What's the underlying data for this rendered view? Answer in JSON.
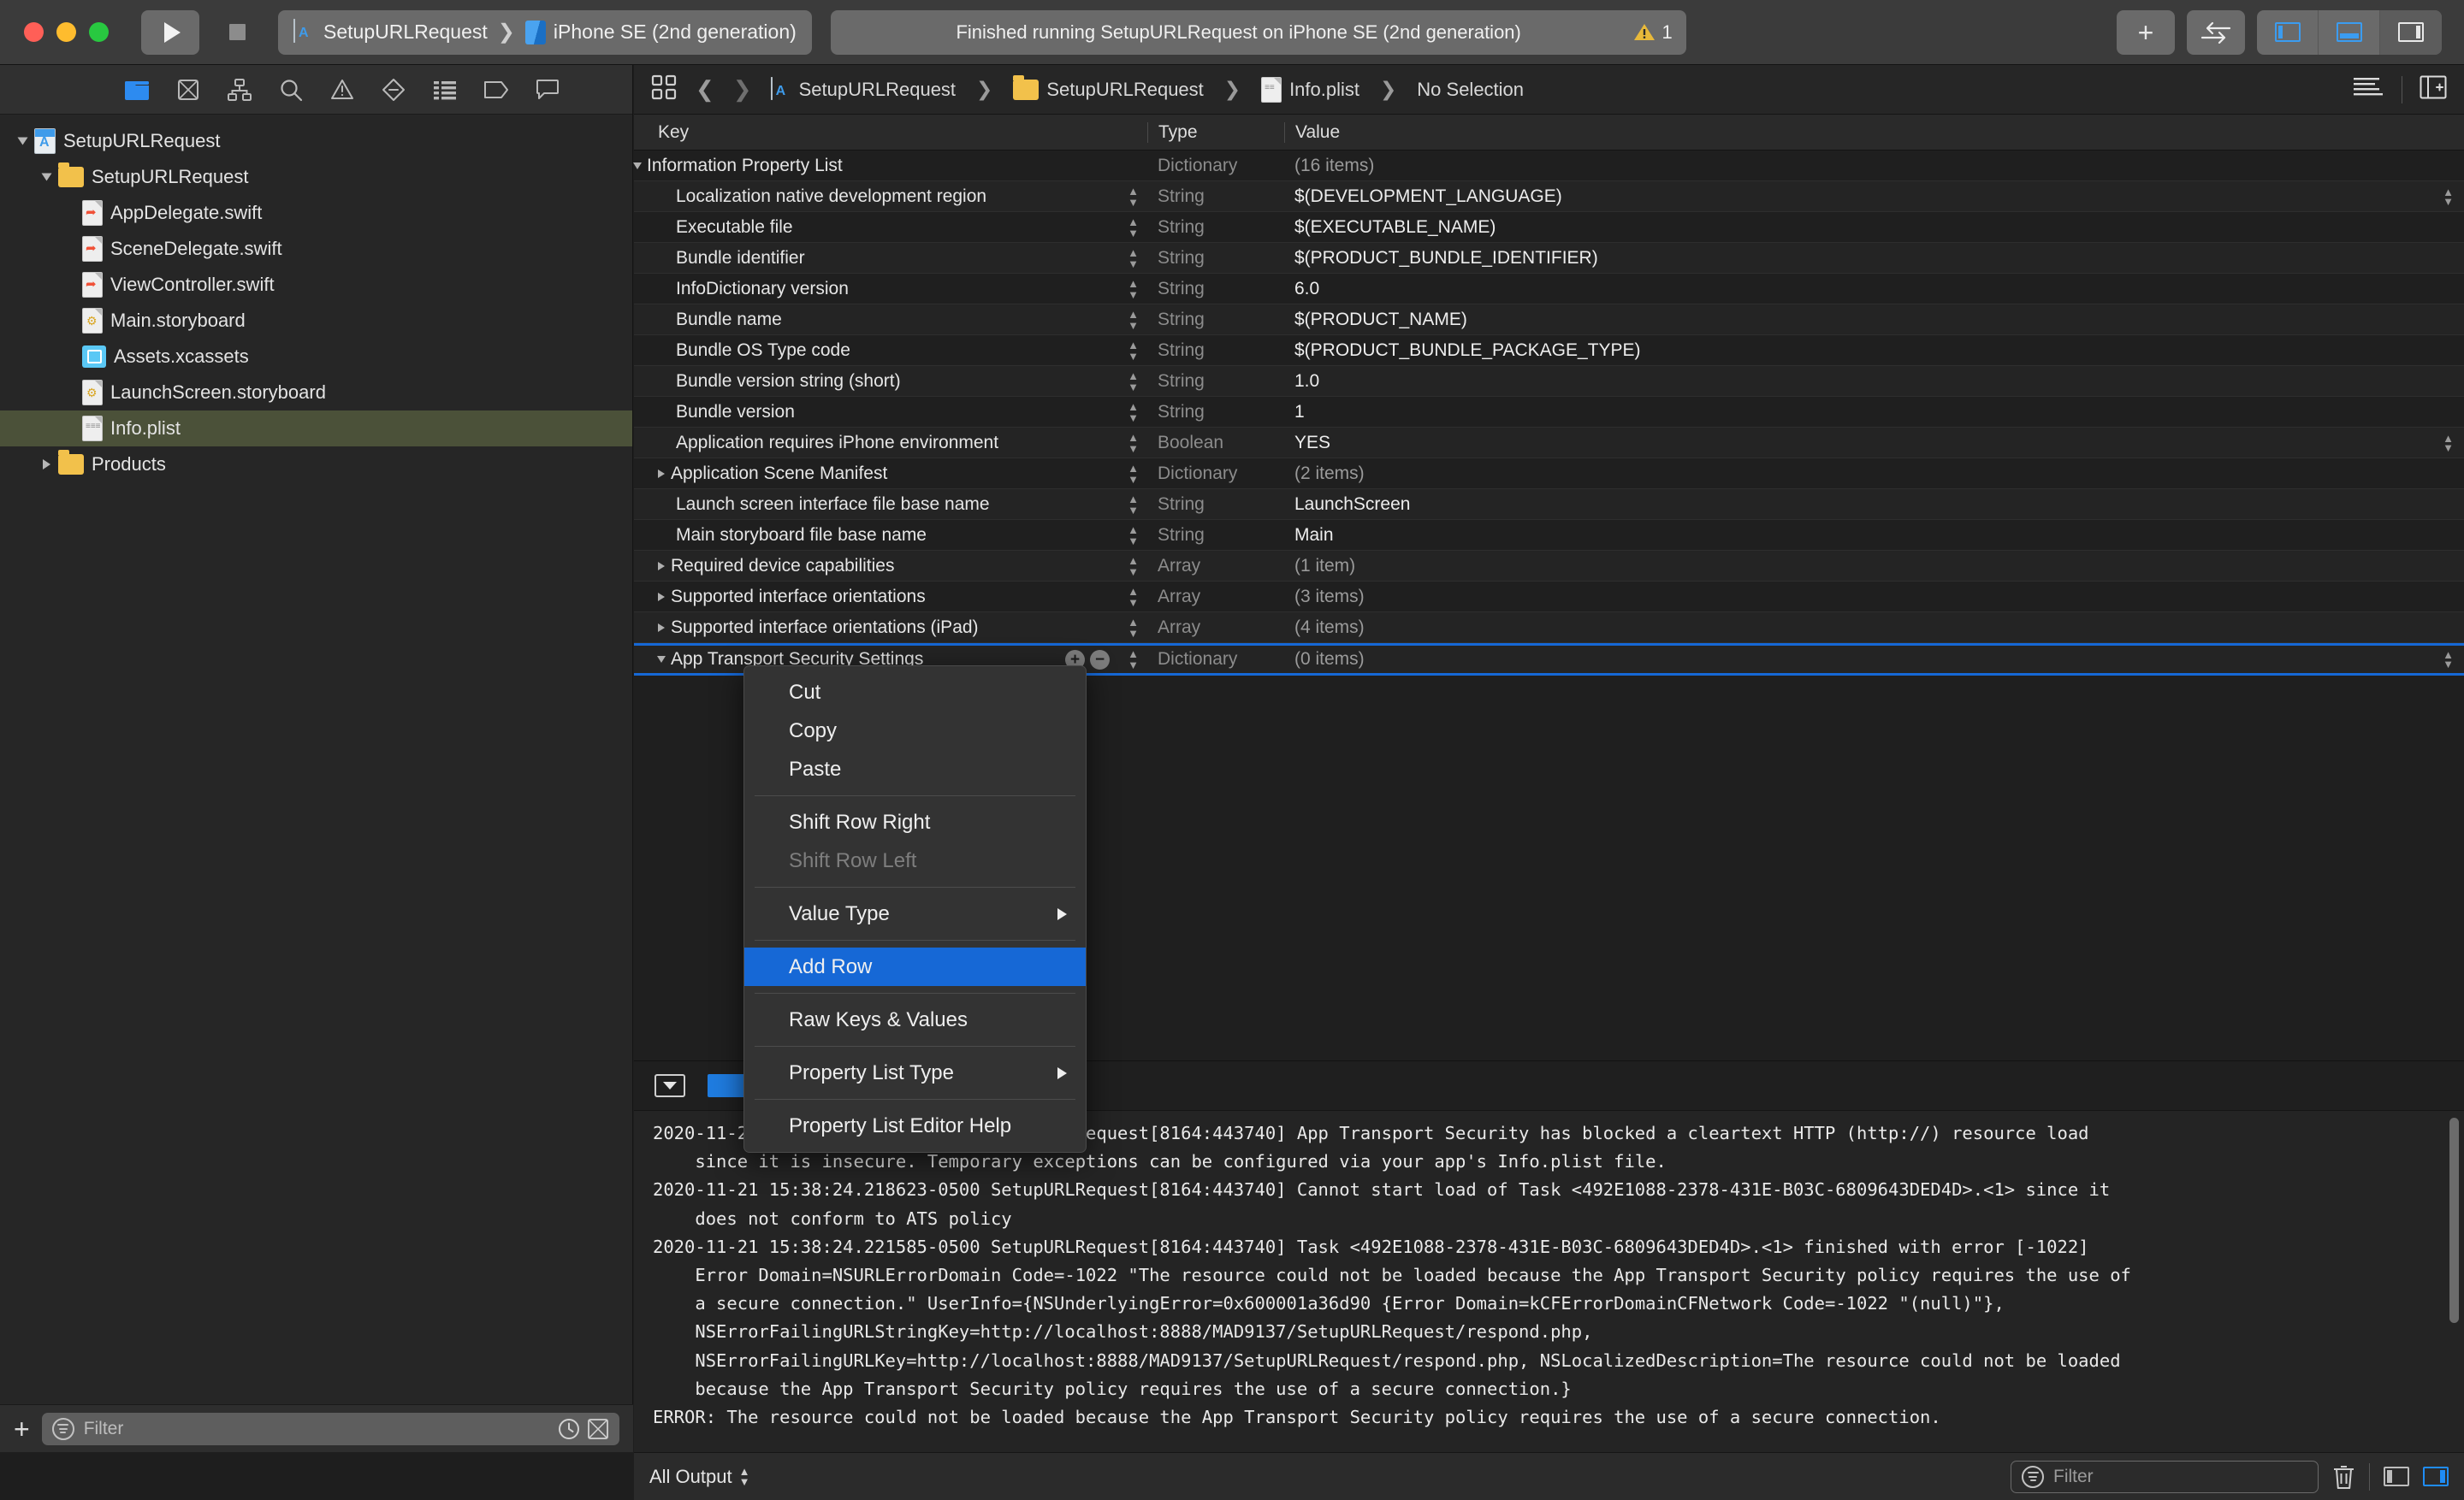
{
  "titlebar": {
    "scheme_name": "SetupURLRequest",
    "destination": "iPhone SE (2nd generation)",
    "status_text": "Finished running SetupURLRequest on iPhone SE (2nd generation)",
    "warning_count": "1",
    "add_label": "+",
    "accent_blue": "#3b9cf0"
  },
  "navigator": {
    "toolbar_icons": [
      "project-navigator-icon",
      "source-control-navigator-icon",
      "symbol-navigator-icon",
      "find-navigator-icon",
      "issue-navigator-icon",
      "test-navigator-icon",
      "debug-navigator-icon",
      "breakpoint-navigator-icon",
      "report-navigator-icon"
    ],
    "tree": [
      {
        "label": "SetupURLRequest",
        "icon": "app-project-icon",
        "depth": 0,
        "state": "open",
        "selected": false
      },
      {
        "label": "SetupURLRequest",
        "icon": "folder-icon",
        "depth": 1,
        "state": "open",
        "selected": false
      },
      {
        "label": "AppDelegate.swift",
        "icon": "swift-file-icon",
        "depth": 2,
        "state": "leaf",
        "selected": false
      },
      {
        "label": "SceneDelegate.swift",
        "icon": "swift-file-icon",
        "depth": 2,
        "state": "leaf",
        "selected": false
      },
      {
        "label": "ViewController.swift",
        "icon": "swift-file-icon",
        "depth": 2,
        "state": "leaf",
        "selected": false
      },
      {
        "label": "Main.storyboard",
        "icon": "storyboard-file-icon",
        "depth": 2,
        "state": "leaf",
        "selected": false
      },
      {
        "label": "Assets.xcassets",
        "icon": "assets-catalog-icon",
        "depth": 2,
        "state": "leaf",
        "selected": false
      },
      {
        "label": "LaunchScreen.storyboard",
        "icon": "storyboard-file-icon",
        "depth": 2,
        "state": "leaf",
        "selected": false
      },
      {
        "label": "Info.plist",
        "icon": "plist-file-icon",
        "depth": 2,
        "state": "leaf",
        "selected": true
      },
      {
        "label": "Products",
        "icon": "folder-icon",
        "depth": 1,
        "state": "closed",
        "selected": false
      }
    ],
    "filter_placeholder": "Filter"
  },
  "jumpbar": {
    "breadcrumbs": [
      {
        "label": "SetupURLRequest",
        "icon": "app-project-icon"
      },
      {
        "label": "SetupURLRequest",
        "icon": "folder-icon"
      },
      {
        "label": "Info.plist",
        "icon": "plist-file-icon"
      },
      {
        "label": "No Selection",
        "icon": ""
      }
    ]
  },
  "plist": {
    "columns": {
      "key": "Key",
      "type": "Type",
      "value": "Value"
    },
    "rows": [
      {
        "key": "Information Property List",
        "type": "Dictionary",
        "value": "(16 items)",
        "depth": 0,
        "disclosure": "open",
        "stepper": false,
        "dim_type": true,
        "dim_value": true,
        "value_stepper": false
      },
      {
        "key": "Localization native development region",
        "type": "String",
        "value": "$(DEVELOPMENT_LANGUAGE)",
        "depth": 1,
        "disclosure": "none",
        "stepper": true,
        "dim_type": true,
        "dim_value": false,
        "value_stepper": true
      },
      {
        "key": "Executable file",
        "type": "String",
        "value": "$(EXECUTABLE_NAME)",
        "depth": 1,
        "disclosure": "none",
        "stepper": true,
        "dim_type": true,
        "dim_value": false,
        "value_stepper": false
      },
      {
        "key": "Bundle identifier",
        "type": "String",
        "value": "$(PRODUCT_BUNDLE_IDENTIFIER)",
        "depth": 1,
        "disclosure": "none",
        "stepper": true,
        "dim_type": true,
        "dim_value": false,
        "value_stepper": false
      },
      {
        "key": "InfoDictionary version",
        "type": "String",
        "value": "6.0",
        "depth": 1,
        "disclosure": "none",
        "stepper": true,
        "dim_type": true,
        "dim_value": false,
        "value_stepper": false
      },
      {
        "key": "Bundle name",
        "type": "String",
        "value": "$(PRODUCT_NAME)",
        "depth": 1,
        "disclosure": "none",
        "stepper": true,
        "dim_type": true,
        "dim_value": false,
        "value_stepper": false
      },
      {
        "key": "Bundle OS Type code",
        "type": "String",
        "value": "$(PRODUCT_BUNDLE_PACKAGE_TYPE)",
        "depth": 1,
        "disclosure": "none",
        "stepper": true,
        "dim_type": true,
        "dim_value": false,
        "value_stepper": false
      },
      {
        "key": "Bundle version string (short)",
        "type": "String",
        "value": "1.0",
        "depth": 1,
        "disclosure": "none",
        "stepper": true,
        "dim_type": true,
        "dim_value": false,
        "value_stepper": false
      },
      {
        "key": "Bundle version",
        "type": "String",
        "value": "1",
        "depth": 1,
        "disclosure": "none",
        "stepper": true,
        "dim_type": true,
        "dim_value": false,
        "value_stepper": false
      },
      {
        "key": "Application requires iPhone environment",
        "type": "Boolean",
        "value": "YES",
        "depth": 1,
        "disclosure": "none",
        "stepper": true,
        "dim_type": true,
        "dim_value": false,
        "value_stepper": true
      },
      {
        "key": "Application Scene Manifest",
        "type": "Dictionary",
        "value": "(2 items)",
        "depth": 1,
        "disclosure": "closed",
        "stepper": true,
        "dim_type": true,
        "dim_value": true,
        "value_stepper": false
      },
      {
        "key": "Launch screen interface file base name",
        "type": "String",
        "value": "LaunchScreen",
        "depth": 1,
        "disclosure": "none",
        "stepper": true,
        "dim_type": true,
        "dim_value": false,
        "value_stepper": false
      },
      {
        "key": "Main storyboard file base name",
        "type": "String",
        "value": "Main",
        "depth": 1,
        "disclosure": "none",
        "stepper": true,
        "dim_type": true,
        "dim_value": false,
        "value_stepper": false
      },
      {
        "key": "Required device capabilities",
        "type": "Array",
        "value": "(1 item)",
        "depth": 1,
        "disclosure": "closed",
        "stepper": true,
        "dim_type": true,
        "dim_value": true,
        "value_stepper": false
      },
      {
        "key": "Supported interface orientations",
        "type": "Array",
        "value": "(3 items)",
        "depth": 1,
        "disclosure": "closed",
        "stepper": true,
        "dim_type": true,
        "dim_value": true,
        "value_stepper": false
      },
      {
        "key": "Supported interface orientations (iPad)",
        "type": "Array",
        "value": "(4 items)",
        "depth": 1,
        "disclosure": "closed",
        "stepper": true,
        "dim_type": true,
        "dim_value": true,
        "value_stepper": false
      },
      {
        "key": "App Transport Security Settings",
        "type": "Dictionary",
        "value": "(0 items)",
        "depth": 1,
        "disclosure": "open",
        "stepper": true,
        "dim_type": true,
        "dim_value": true,
        "value_stepper": true,
        "selected": true,
        "plusminus": true
      }
    ]
  },
  "context_menu": {
    "items": [
      {
        "label": "Cut",
        "state": "normal",
        "submenu": false
      },
      {
        "label": "Copy",
        "state": "normal",
        "submenu": false
      },
      {
        "label": "Paste",
        "state": "normal",
        "submenu": false
      },
      {
        "separator": true
      },
      {
        "label": "Shift Row Right",
        "state": "normal",
        "submenu": false
      },
      {
        "label": "Shift Row Left",
        "state": "disabled",
        "submenu": false
      },
      {
        "separator": true
      },
      {
        "label": "Value Type",
        "state": "normal",
        "submenu": true
      },
      {
        "separator": true
      },
      {
        "label": "Add Row",
        "state": "highlighted",
        "submenu": false
      },
      {
        "separator": true
      },
      {
        "label": "Raw Keys & Values",
        "state": "normal",
        "submenu": false
      },
      {
        "separator": true
      },
      {
        "label": "Property List Type",
        "state": "normal",
        "submenu": true
      },
      {
        "separator": true
      },
      {
        "label": "Property List Editor Help",
        "state": "normal",
        "submenu": false
      }
    ],
    "highlight_color": "#1668d6"
  },
  "console": {
    "text": "2020-11-21 15:38:24.218479-0500 SetupURLRequest[8164:443740] App Transport Security has blocked a cleartext HTTP (http://) resource load\n    since it is insecure. Temporary exceptions can be configured via your app's Info.plist file.\n2020-11-21 15:38:24.218623-0500 SetupURLRequest[8164:443740] Cannot start load of Task <492E1088-2378-431E-B03C-6809643DED4D>.<1> since it\n    does not conform to ATS policy\n2020-11-21 15:38:24.221585-0500 SetupURLRequest[8164:443740] Task <492E1088-2378-431E-B03C-6809643DED4D>.<1> finished with error [-1022]\n    Error Domain=NSURLErrorDomain Code=-1022 \"The resource could not be loaded because the App Transport Security policy requires the use of\n    a secure connection.\" UserInfo={NSUnderlyingError=0x600001a36d90 {Error Domain=kCFErrorDomainCFNetwork Code=-1022 \"(null)\"},\n    NSErrorFailingURLStringKey=http://localhost:8888/MAD9137/SetupURLRequest/respond.php,\n    NSErrorFailingURLKey=http://localhost:8888/MAD9137/SetupURLRequest/respond.php, NSLocalizedDescription=The resource could not be loaded\n    because the App Transport Security policy requires the use of a secure connection.}\nERROR: The resource could not be loaded because the App Transport Security policy requires the use of a secure connection."
  },
  "bottombar": {
    "scope_label": "All Output",
    "filter_placeholder": "Filter"
  }
}
